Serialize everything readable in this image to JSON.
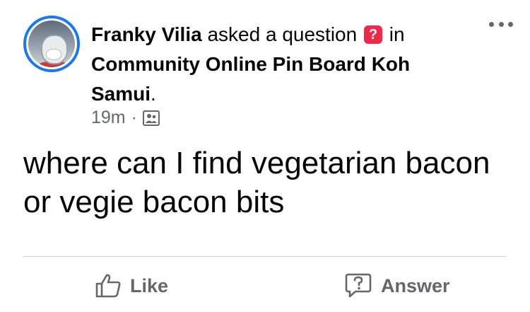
{
  "post": {
    "author": "Franky Vilia",
    "action_text": "asked a question",
    "question_badge": "?",
    "in_text": "in",
    "group_line1": "Community Online Pin Board Koh",
    "group_line2": "Samui",
    "group_suffix": ".",
    "timestamp": "19m",
    "separator": "·",
    "body_line1": "where can I find vegetarian bacon",
    "body_line2": "or vegie bacon bits"
  },
  "actions": {
    "like_label": "Like",
    "answer_label": "Answer"
  },
  "icons": {
    "more": "more-options-icon",
    "audience": "group-icon",
    "like": "thumbs-up-icon",
    "answer": "question-bubble-icon"
  },
  "colors": {
    "avatar_ring": "#1877f2",
    "question_badge": "#f02849",
    "secondary_text": "#65676b",
    "divider": "#ced0d4"
  }
}
